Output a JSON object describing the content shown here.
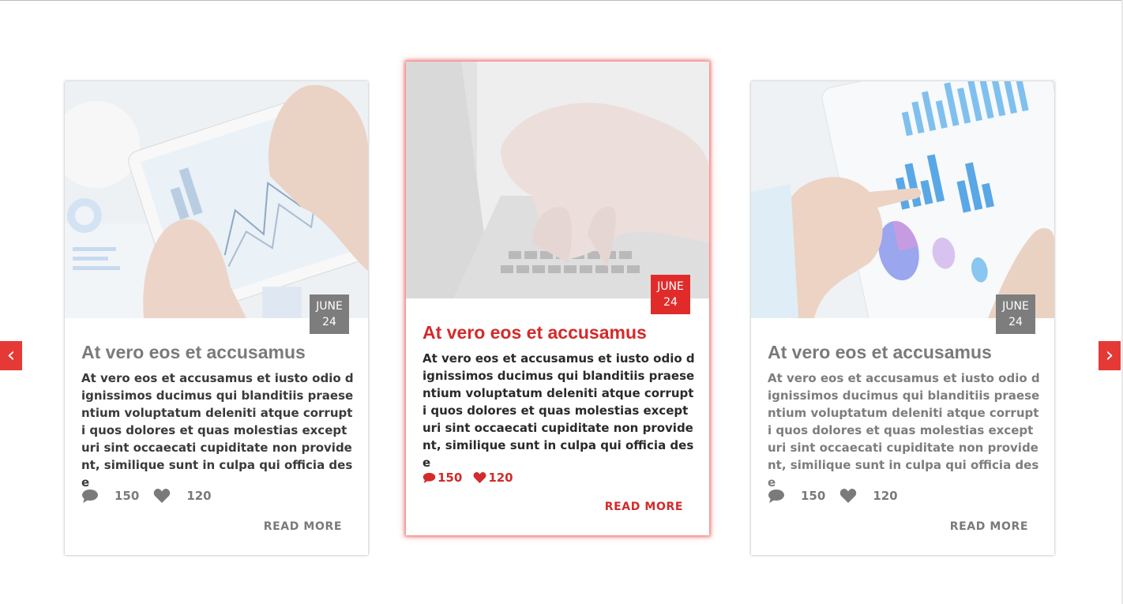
{
  "colors": {
    "accent": "#e53935",
    "date_inactive": "#7d7d7d",
    "text_gray": "#7a7a7a"
  },
  "nav": {
    "prev_label": "‹",
    "next_label": "›"
  },
  "cards": [
    {
      "image": "tablet-analytics-photo",
      "date_month": "JUNE",
      "date_day": "24",
      "title": "At vero eos et accusamus",
      "body": "At vero eos et accusamus et iusto odio dignissimos ducimus qui blanditiis praesentium voluptatum deleniti atque corrupti quos dolores et quas molestias excepturi sint occaecati cupiditate non provident, similique sunt in culpa qui officia dese",
      "comments": "150",
      "likes": "120",
      "read_more": "READ MORE"
    },
    {
      "image": "laptop-typing-photo",
      "date_month": "JUNE",
      "date_day": "24",
      "title": "At vero eos et accusamus",
      "body": "At vero eos et accusamus et iusto odio dignissimos ducimus qui blanditiis praesentium voluptatum deleniti atque corrupti quos dolores et quas molestias excepturi sint occaecati cupiditate non provident, similique sunt in culpa qui officia dese",
      "comments": "150",
      "likes": "120",
      "read_more": "READ MORE"
    },
    {
      "image": "tablet-bar-chart-photo",
      "date_month": "JUNE",
      "date_day": "24",
      "title": "At vero eos et accusamus",
      "body": "At vero eos et accusamus et iusto odio dignissimos ducimus qui blanditiis praesentium voluptatum deleniti atque corrupti quos dolores et quas molestias excepturi sint occaecati cupiditate non provident, similique sunt in culpa qui officia dese",
      "comments": "150",
      "likes": "120",
      "read_more": "READ MORE"
    }
  ]
}
